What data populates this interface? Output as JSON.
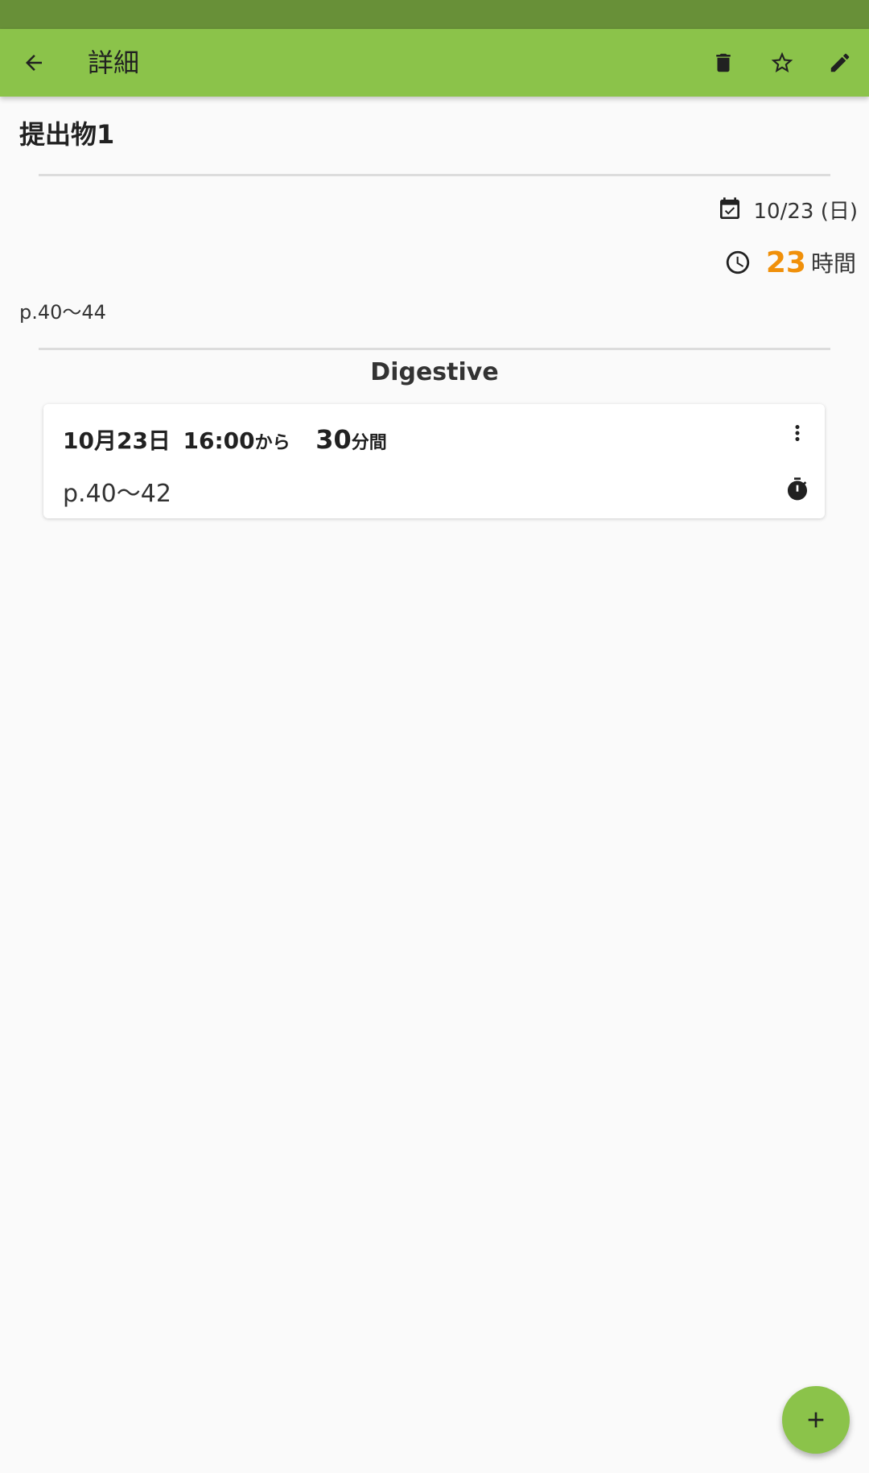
{
  "app_bar": {
    "title": "詳細",
    "icons": [
      "arrow-back-icon",
      "trash-icon",
      "star-outline-icon",
      "edit-pencil-icon"
    ]
  },
  "task": {
    "title": "提出物1",
    "due_date": "10/23 (日)",
    "remaining_value": "23",
    "remaining_unit": "時間",
    "memo": "p.40〜44"
  },
  "subject": {
    "name": "Digestive"
  },
  "plan_card": {
    "date": "10月23日",
    "start_time": "16:00",
    "start_suffix": "から",
    "duration_value": "30",
    "duration_unit": "分間",
    "content": "p.40〜42"
  },
  "colors": {
    "status_bar": "#689038",
    "app_bar": "#8bc34a",
    "accent_orange": "#f0900a",
    "fab": "#8bc34a"
  }
}
